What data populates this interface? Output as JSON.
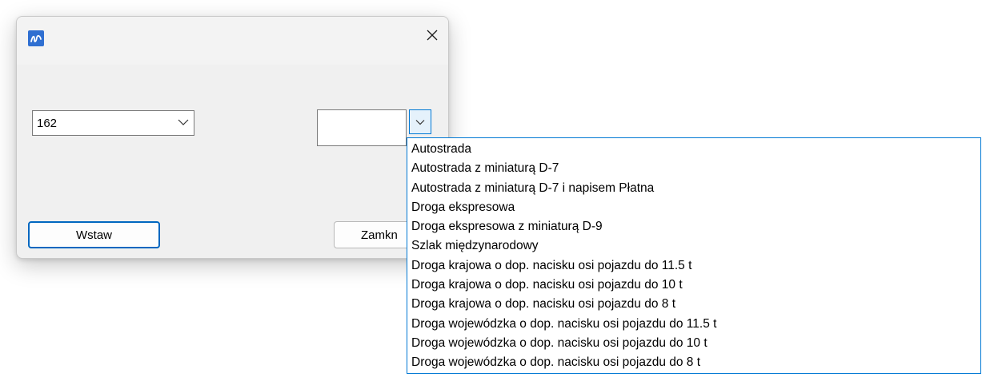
{
  "dialog": {
    "close_glyph": "✕",
    "left_combo": {
      "value": "162"
    },
    "right_combo": {
      "value": ""
    },
    "buttons": {
      "insert_label": "Wstaw",
      "close_label": "Zamkn"
    }
  },
  "dropdown": {
    "items": [
      "Autostrada",
      "Autostrada z miniaturą D-7",
      "Autostrada z miniaturą D-7 i napisem Płatna",
      "Droga ekspresowa",
      "Droga ekspresowa z miniaturą D-9",
      "Szlak międzynarodowy",
      "Droga krajowa o dop. nacisku osi pojazdu do 11.5 t",
      "Droga krajowa o dop. nacisku osi pojazdu do 10 t",
      "Droga krajowa o dop. nacisku osi pojazdu do 8 t",
      "Droga wojewódzka o dop. nacisku osi pojazdu do 11.5 t",
      "Droga wojewódzka o dop. nacisku osi pojazdu do 10 t",
      "Droga wojewódzka o dop. nacisku osi pojazdu do 8 t"
    ]
  },
  "icons": {
    "app": "app-icon",
    "close": "close-icon",
    "chevron": "chevron-down-icon"
  },
  "colors": {
    "accent": "#0078d4",
    "app_icon": "#2f6fd1",
    "dialog_bg": "#f0f0f0"
  }
}
